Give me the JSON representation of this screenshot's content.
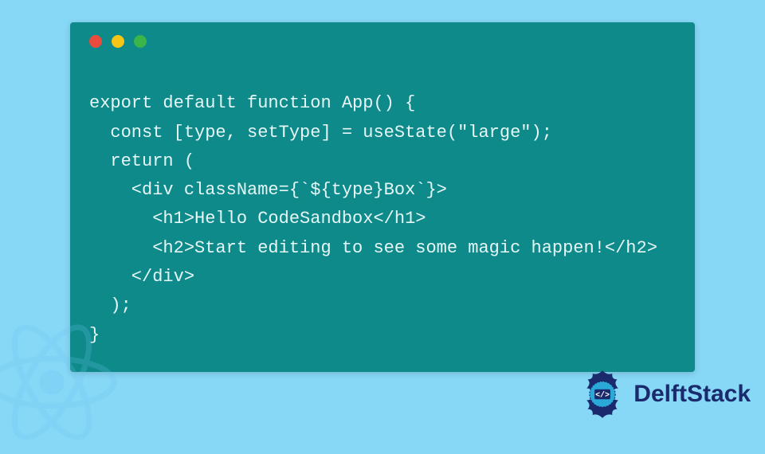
{
  "code": {
    "lines": [
      "export default function App() {",
      "  const [type, setType] = useState(\"large\");",
      "  return (",
      "    <div className={`${type}Box`}>",
      "      <h1>Hello CodeSandbox</h1>",
      "      <h2>Start editing to see some magic happen!</h2>",
      "    </div>",
      "  );",
      "}"
    ]
  },
  "window": {
    "dots": [
      "red",
      "yellow",
      "green"
    ]
  },
  "branding": {
    "name": "DelftStack"
  },
  "colors": {
    "page_bg": "#87d7f7",
    "window_bg": "#0e8a8a",
    "code_fg": "#e6f7f7",
    "brand_fg": "#1a2a6c"
  }
}
